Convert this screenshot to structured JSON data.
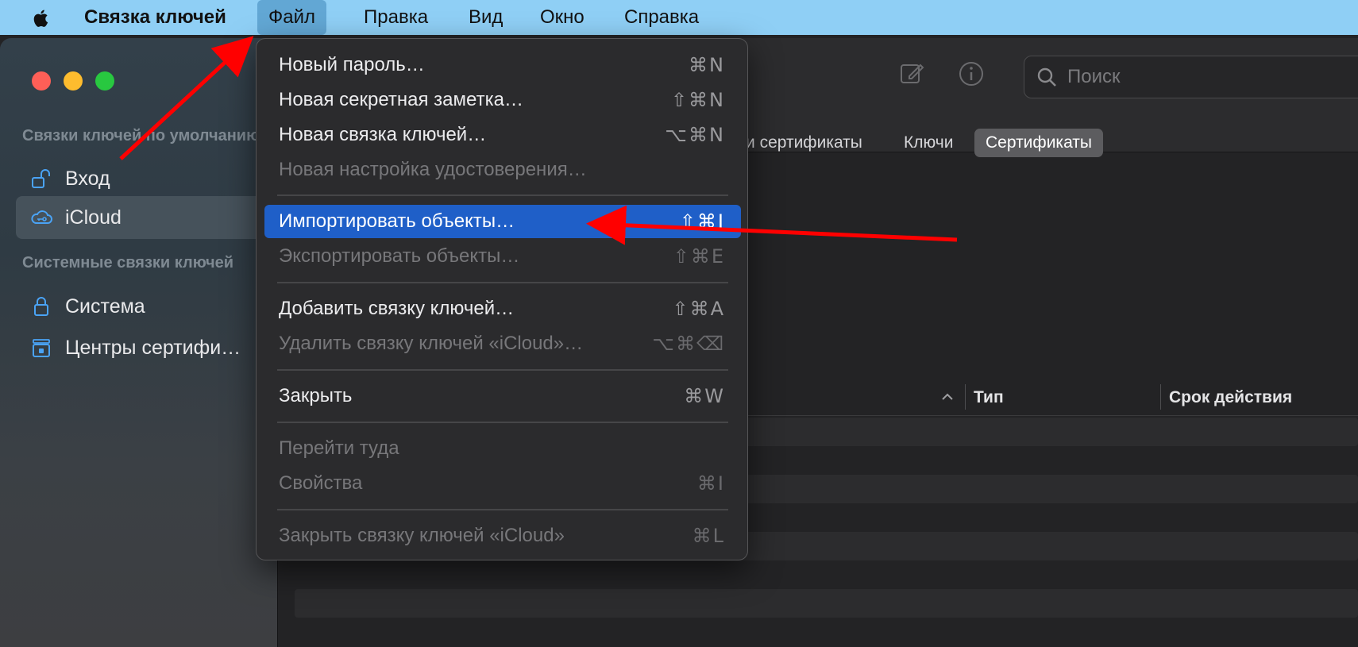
{
  "menubar": {
    "app_name": "Связка ключей",
    "items": [
      "Файл",
      "Правка",
      "Вид",
      "Окно",
      "Справка"
    ],
    "apple_icon": "apple-icon"
  },
  "sidebar": {
    "section_default": "Связки ключей по умолчанию",
    "section_system": "Системные связки ключей",
    "items": [
      {
        "label": "Вход",
        "icon": "unlocked-padlock-icon"
      },
      {
        "label": "iCloud",
        "icon": "icloud-key-icon",
        "selected": true
      },
      {
        "label": "Система",
        "icon": "padlock-icon"
      },
      {
        "label": "Центры сертифи…",
        "icon": "certificate-lock-icon"
      }
    ]
  },
  "toolbar": {
    "search_placeholder": "Поиск"
  },
  "tabs": [
    "и сертификаты",
    "Ключи",
    "Сертификаты"
  ],
  "selected_tab": "Сертификаты",
  "columns": [
    "Тип",
    "Срок действия"
  ],
  "file_menu": {
    "items": [
      {
        "label": "Новый пароль…",
        "shortcut": "⌘N",
        "disabled": false
      },
      {
        "label": "Новая секретная заметка…",
        "shortcut": "⇧⌘N",
        "disabled": false
      },
      {
        "label": "Новая связка ключей…",
        "shortcut": "⌥⌘N",
        "disabled": false
      },
      {
        "label": "Новая настройка удостоверения…",
        "shortcut": "",
        "disabled": true
      },
      {
        "label": "Импортировать объекты…",
        "shortcut": "⇧⌘I",
        "disabled": false,
        "highlighted": true
      },
      {
        "label": "Экспортировать объекты…",
        "shortcut": "⇧⌘E",
        "disabled": true
      },
      {
        "label": "Добавить связку ключей…",
        "shortcut": "⇧⌘A",
        "disabled": false
      },
      {
        "label": "Удалить связку ключей «iCloud»…",
        "shortcut": "⌥⌘⌫",
        "disabled": true
      },
      {
        "label": "Закрыть",
        "shortcut": "⌘W",
        "disabled": false
      },
      {
        "label": "Перейти туда",
        "shortcut": "",
        "disabled": true
      },
      {
        "label": "Свойства",
        "shortcut": "⌘I",
        "disabled": true
      },
      {
        "label": "Закрыть связку ключей «iCloud»",
        "shortcut": "⌘L",
        "disabled": true
      }
    ]
  },
  "colors": {
    "menubar_bg": "#8fcff5",
    "highlight": "#1f5fc8",
    "annotation_arrow": "#ff0000"
  }
}
